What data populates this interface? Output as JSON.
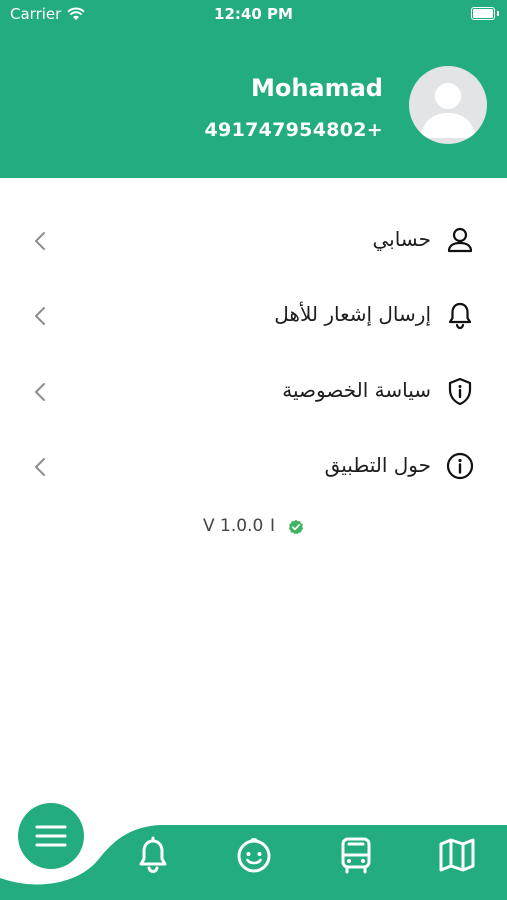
{
  "status_bar": {
    "carrier": "Carrier",
    "time": "12:40 PM"
  },
  "profile": {
    "name": "Mohamad",
    "phone": "491747954802+"
  },
  "menu": [
    {
      "label": "حسابي",
      "icon": "user-icon"
    },
    {
      "label": "إرسال إشعار للأهل",
      "icon": "bell-icon"
    },
    {
      "label": "سياسة الخصوصية",
      "icon": "shield-info-icon"
    },
    {
      "label": "حول التطبيق",
      "icon": "info-icon"
    }
  ],
  "version": {
    "text": "V 1.0.0",
    "separator": "I"
  },
  "bottom_nav": {
    "icons": [
      "menu-icon",
      "bell-icon",
      "child-face-icon",
      "bus-icon",
      "map-icon"
    ]
  },
  "colors": {
    "primary": "#22ac7f",
    "text": "#1d1d1d",
    "muted": "#8d8d8d",
    "check": "#3eb463"
  }
}
